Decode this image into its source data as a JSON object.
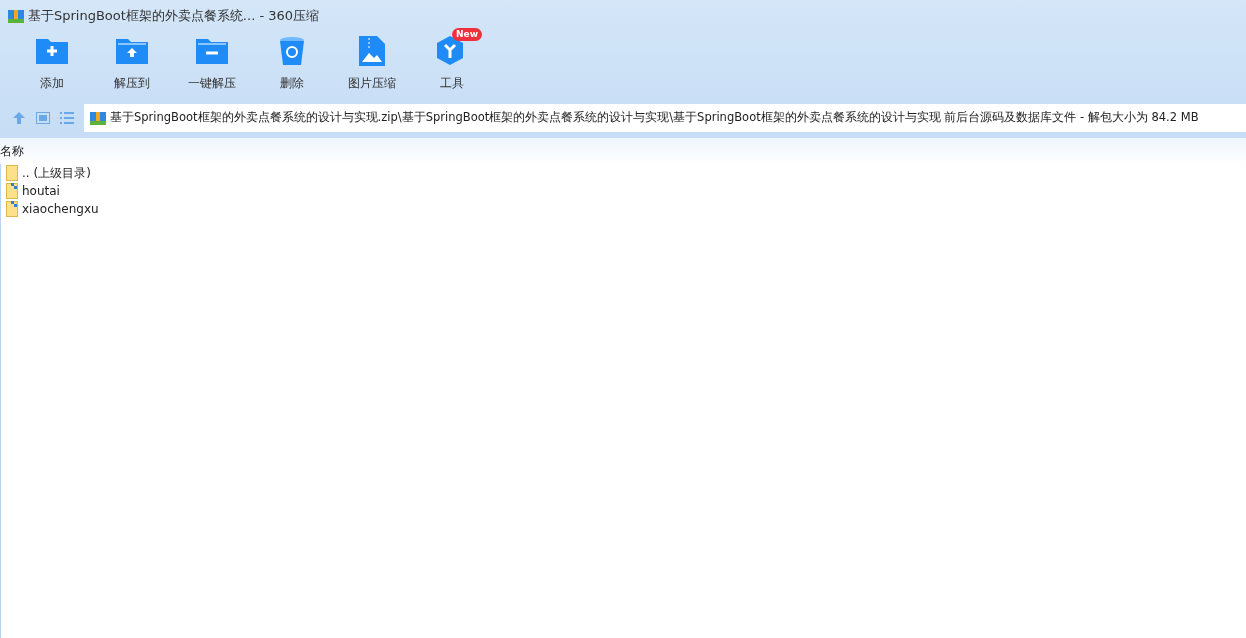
{
  "window": {
    "title": "基于SpringBoot框架的外卖点餐系统... - 360压缩"
  },
  "toolbar": [
    {
      "kind": "add",
      "label": "添加"
    },
    {
      "kind": "extract-to",
      "label": "解压到"
    },
    {
      "kind": "one-click",
      "label": "一键解压"
    },
    {
      "kind": "delete",
      "label": "删除"
    },
    {
      "kind": "image",
      "label": "图片压缩"
    },
    {
      "kind": "tools",
      "label": "工具",
      "badge": "New"
    }
  ],
  "address": {
    "path": "基于SpringBoot框架的外卖点餐系统的设计与实现.zip\\基于SpringBoot框架的外卖点餐系统的设计与实现\\基于SpringBoot框架的外卖点餐系统的设计与实现 前后台源码及数据库文件 - 解包大小为 84.2 MB"
  },
  "table": {
    "columns": [
      "名称"
    ],
    "rows": [
      {
        "kind": "parent",
        "name": ".. (上级目录)"
      },
      {
        "kind": "folder",
        "name": "houtai"
      },
      {
        "kind": "folder",
        "name": "xiaochengxu"
      }
    ]
  }
}
